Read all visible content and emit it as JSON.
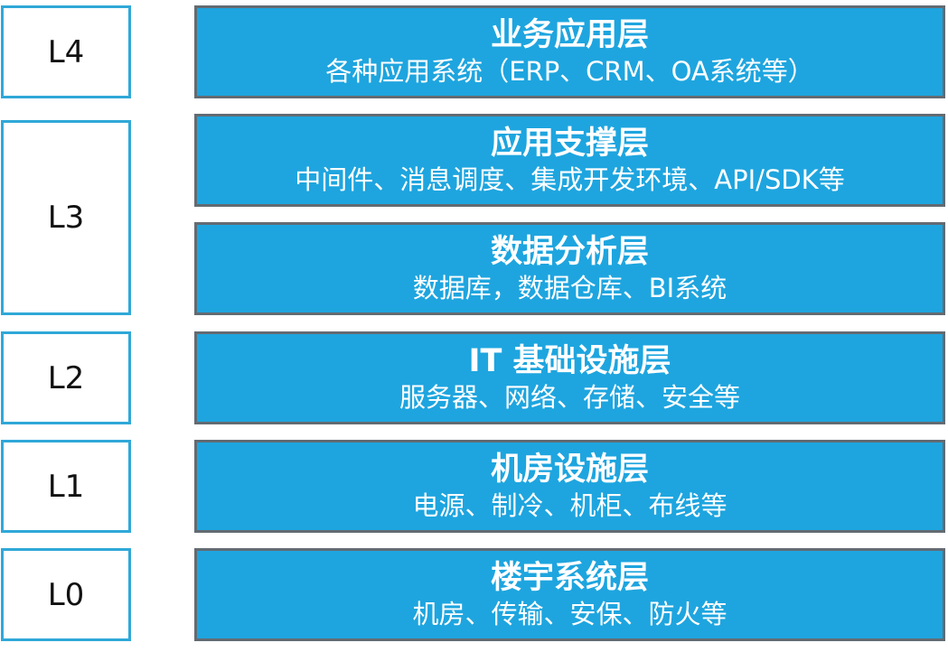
{
  "levels": [
    {
      "id": "L4",
      "label": "L4"
    },
    {
      "id": "L3",
      "label": "L3"
    },
    {
      "id": "L2",
      "label": "L2"
    },
    {
      "id": "L1",
      "label": "L1"
    },
    {
      "id": "L0",
      "label": "L0"
    }
  ],
  "layers": [
    {
      "title": "业务应用层",
      "subtitle": "各种应用系统（ERP、CRM、OA系统等）"
    },
    {
      "title": "应用支撑层",
      "subtitle": "中间件、消息调度、集成开发环境、API/SDK等"
    },
    {
      "title": "数据分析层",
      "subtitle": "数据库，数据仓库、BI系统"
    },
    {
      "title": "IT 基础设施层",
      "subtitle": "服务器、网络、存储、安全等"
    },
    {
      "title": "机房设施层",
      "subtitle": "电源、制冷、机柜、布线等"
    },
    {
      "title": "楼宇系统层",
      "subtitle": "机房、传输、安保、防火等"
    }
  ],
  "colors": {
    "level_border": "#2fa8d8",
    "layer_fill": "#1ea5df",
    "layer_border": "#636b72",
    "layer_text": "#ffffff"
  }
}
